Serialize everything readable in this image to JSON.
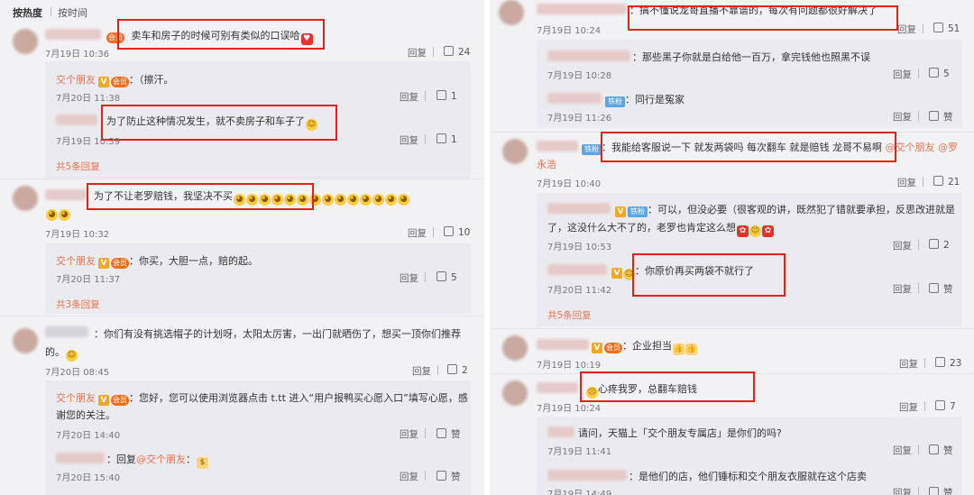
{
  "left": {
    "sort_tabs": [
      "按热度",
      "按时间"
    ],
    "c1": {
      "text": "卖车和房子的时候可别有类似的口误哈",
      "time": "7月19日 10:36",
      "reply": "回复",
      "likes": "24"
    },
    "c1r1": {
      "name": "交个朋友",
      "text": "（擦汗。",
      "time": "7月20日 11:38",
      "reply": "回复",
      "likes": "1"
    },
    "c1r2": {
      "text": "为了防止这种情况发生，就不卖房子和车子了",
      "time": "7月19日 10:39",
      "reply": "回复",
      "likes": "1"
    },
    "c1_more": "共5条回复",
    "c2": {
      "text": "为了不让老罗赔钱，我坚决不买",
      "time": "7月19日 10:32",
      "reply": "回复",
      "likes": "10"
    },
    "c2r1": {
      "name": "交个朋友",
      "text": "你买，大胆一点，赔的起。",
      "time": "7月20日 11:37",
      "reply": "回复",
      "likes": "5"
    },
    "c2_more": "共3条回复",
    "c3": {
      "text_line1": "：你们有没有挑选帽子的计划呀，太阳太厉害，一出门就晒伤了，想买一顶你们推荐",
      "text_line2": "的。",
      "time": "7月20日 08:45",
      "reply": "回复",
      "likes": "2"
    },
    "c3r1": {
      "name": "交个朋友",
      "text_line1": "：您好，您可以使用浏览器点击 t.tt 进入“用户报鸭买心愿入口”填写心愿，感",
      "text_line2": "谢您的关注。",
      "time": "7月20日 14:40",
      "reply": "回复",
      "likes": "赞"
    },
    "c3r2": {
      "prefix": "：回复",
      "mention": "@交个朋友",
      "time": "7月20日 15:40",
      "reply": "回复",
      "likes": "赞"
    }
  },
  "right": {
    "c1": {
      "text": "：搞不懂说龙哥直播不靠谱的，每次有问题都很好解决了",
      "time": "7月19日 10:24",
      "reply": "回复",
      "likes": "51"
    },
    "c1r1": {
      "text": "：那些黑子你就是白给他一百万，拿完钱他也照黑不误",
      "time": "7月19日 10:28",
      "reply": "回复",
      "likes": "5"
    },
    "c1r2": {
      "text": "：同行是冤家",
      "time": "7月19日 11:26",
      "reply": "回复",
      "likes": "赞"
    },
    "c2": {
      "text": "：我能给客服说一下 就发两袋吗 每次翻车 就是赔钱 龙哥不易啊",
      "mention1": "@交个朋友",
      "mention2": "@罗",
      "mention2b": "永浩",
      "time": "7月19日 10:40",
      "reply": "回复",
      "likes": "21"
    },
    "c2r1": {
      "text_line1": "：可以，但没必要（很客观的讲，既然犯了错就要承担，反思改进就是",
      "text_line2": "了，这没什么大不了的，老罗也肯定这么想",
      "time": "7月19日 10:53",
      "reply": "回复",
      "likes": "2"
    },
    "c2r2": {
      "text": "：你原价再买两袋不就行了",
      "time": "7月20日 11:42",
      "reply": "回复",
      "likes": "赞"
    },
    "c2_more": "共5条回复",
    "c3": {
      "text": "：企业担当",
      "time": "7月19日 10:19",
      "reply": "回复",
      "likes": "23"
    },
    "c4": {
      "text": "心疼我罗，总翻车赔钱",
      "time": "7月19日 10:24",
      "reply": "回复",
      "likes": "7"
    },
    "c4r1": {
      "text": "请问，天猫上「交个朋友专属店」是你们的吗?",
      "time": "7月19日 11:41",
      "reply": "回复",
      "likes": "赞"
    },
    "c4r2": {
      "text": "：是他们的店，他们锤标和交个朋友衣服就在这个店卖",
      "time": "7月19日 14:49",
      "reply": "回复",
      "likes": "赞"
    }
  },
  "labels": {
    "badge_v": "V",
    "badge_fan": "铁粉",
    "badge_vip": "会员"
  },
  "colors": {
    "highlight": "#e2231a",
    "name": "#eb7350",
    "panel_bg": "#f2f2f5"
  }
}
